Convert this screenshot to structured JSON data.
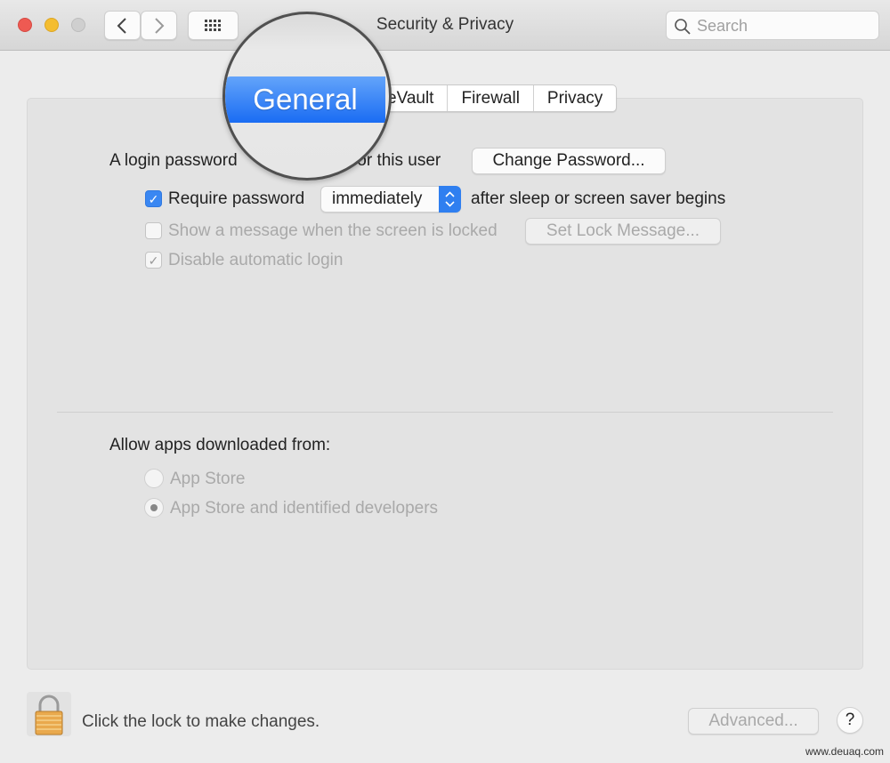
{
  "window": {
    "title": "Security & Privacy",
    "traffic_colors": {
      "close": "#ee5a52",
      "minimize": "#f4bd30",
      "zoom": "#cfcfcf"
    }
  },
  "toolbar": {
    "back_icon": "chevron-left-icon",
    "forward_icon": "chevron-right-icon",
    "grid_icon": "grid-icon",
    "search_placeholder": "Search"
  },
  "tabs": [
    {
      "label": "General",
      "selected": true
    },
    {
      "label": "eVault"
    },
    {
      "label": "Firewall"
    },
    {
      "label": "Privacy"
    }
  ],
  "general": {
    "login_text_left": "A login password",
    "login_text_right": "for this user",
    "change_password": "Change Password...",
    "require_password": {
      "label": "Require password",
      "checked": true
    },
    "delay_select": "immediately",
    "after_text": "after sleep or screen saver begins",
    "show_message": {
      "label": "Show a message when the screen is locked",
      "checked": false,
      "enabled": false
    },
    "set_lock_message": "Set Lock Message...",
    "disable_auto_login": {
      "label": "Disable automatic login",
      "checked": true,
      "enabled": false
    },
    "allow_apps_label": "Allow apps downloaded from:",
    "radio_options": [
      {
        "label": "App Store",
        "selected": false
      },
      {
        "label": "App Store and identified developers",
        "selected": true
      }
    ]
  },
  "footer": {
    "lock_text": "Click the lock to make changes.",
    "advanced": "Advanced...",
    "help": "?"
  },
  "accent": "#3a87f2",
  "watermark": "www.deuaq.com"
}
